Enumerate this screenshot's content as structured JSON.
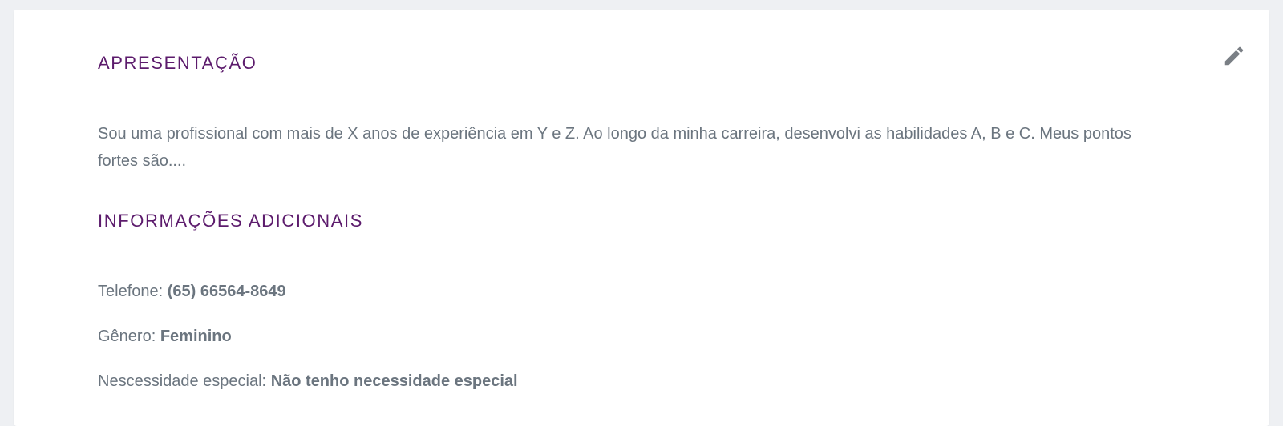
{
  "colors": {
    "background": "#eef0f3",
    "card": "#ffffff",
    "heading": "#5c1b6c",
    "text": "#6b757f",
    "icon": "#7a7f85"
  },
  "edit": {
    "icon": "pencil-icon"
  },
  "presentation": {
    "title": "APRESENTAÇÃO",
    "text": "Sou uma profissional com mais de X anos de experiência em Y e Z. Ao longo da minha carreira, desenvolvi as habilidades A, B e C. Meus pontos fortes são...."
  },
  "additional_info": {
    "title": "INFORMAÇÕES ADICIONAIS",
    "phone": {
      "label": "Telefone:",
      "value": "(65) 66564-8649"
    },
    "gender": {
      "label": "Gênero:",
      "value": "Feminino"
    },
    "special_need": {
      "label": "Nescessidade especial:",
      "value": "Não tenho necessidade especial"
    }
  }
}
